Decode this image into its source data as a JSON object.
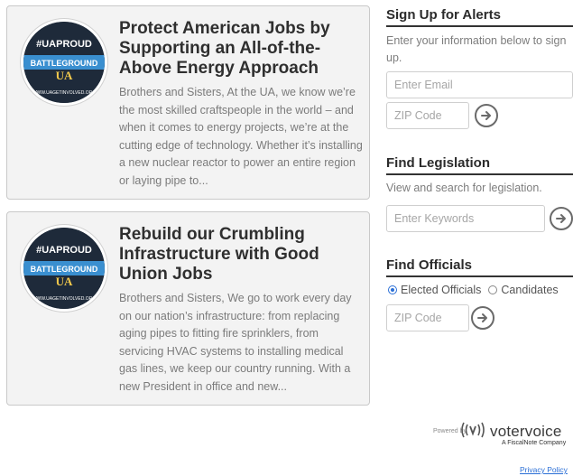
{
  "cards": [
    {
      "badge": {
        "top_text": "#UAPROUD",
        "banner_text": "BATTLEGROUND",
        "mark": "UA",
        "bottom_text": "WWW.UAGETINVOLVED.ORG"
      },
      "title": "Protect American Jobs by Supporting an All-of-the-Above Energy Approach",
      "body": "Brothers and Sisters,   At the UA, we know we’re the most skilled craftspeople in the world – and when it comes to energy projects, we’re at the cutting edge of technology. Whether it’s installing a new nuclear reactor to power an entire region or laying pipe to..."
    },
    {
      "badge": {
        "top_text": "#UAPROUD",
        "banner_text": "BATTLEGROUND",
        "mark": "UA",
        "bottom_text": "WWW.UAGETINVOLVED.ORG"
      },
      "title": "Rebuild our Crumbling Infrastructure with Good Union Jobs",
      "body": "Brothers and Sisters,   We go to work every day on our nation’s infrastructure: from replacing aging pipes to fitting fire sprinklers, from servicing HVAC systems to installing medical gas lines, we keep our country running. With a new President in office and new..."
    }
  ],
  "alerts": {
    "heading": "Sign Up for Alerts",
    "description": "Enter your information below to sign up.",
    "email_placeholder": "Enter Email",
    "zip_placeholder": "ZIP Code"
  },
  "legislation": {
    "heading": "Find Legislation",
    "description": "View and search for legislation.",
    "keywords_placeholder": "Enter Keywords"
  },
  "officials": {
    "heading": "Find Officials",
    "options": [
      "Elected Officials",
      "Candidates"
    ],
    "selected": "Elected Officials",
    "zip_placeholder": "ZIP Code"
  },
  "footer": {
    "powered_by": "Powered by",
    "brand": "votervoice",
    "brand_sub": "A FiscalNote Company",
    "privacy": "Privacy Policy"
  },
  "icons": {
    "go": "arrow-right-circle-icon"
  },
  "colors": {
    "accent": "#2b6fd6",
    "badge_bg": "#1e2a3a",
    "badge_banner": "#3a8fd0",
    "card_bg": "#f3f3f3"
  }
}
